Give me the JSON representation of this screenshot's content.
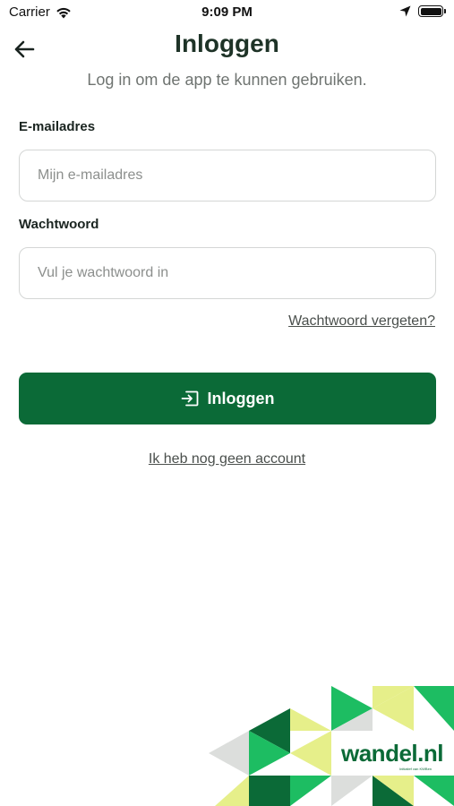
{
  "status_bar": {
    "carrier": "Carrier",
    "time": "9:09 PM",
    "icons": [
      "wifi-icon",
      "location-arrow-icon",
      "battery-icon"
    ]
  },
  "header": {
    "back_icon": "arrow-left-icon",
    "title": "Inloggen",
    "subtitle": "Log in om de app te kunnen gebruiken."
  },
  "form": {
    "email": {
      "label": "E-mailadres",
      "value": "",
      "placeholder": "Mijn e-mailadres"
    },
    "password": {
      "label": "Wachtwoord",
      "value": "",
      "placeholder": "Vul je wachtwoord in"
    },
    "forgot_link": "Wachtwoord vergeten?",
    "submit": {
      "label": "Inloggen",
      "icon": "login-icon"
    },
    "no_account_link": "Ik heb nog geen account"
  },
  "branding": {
    "logo": "wandel.nl",
    "tagline": "Initiatief van KWBen"
  },
  "colors": {
    "primary_green": "#0b6a37",
    "bright_green": "#1dbd62",
    "lime": "#e6ef8a",
    "light_gray": "#dcdedc",
    "title": "#1e3327",
    "muted_text": "#6f7471"
  }
}
